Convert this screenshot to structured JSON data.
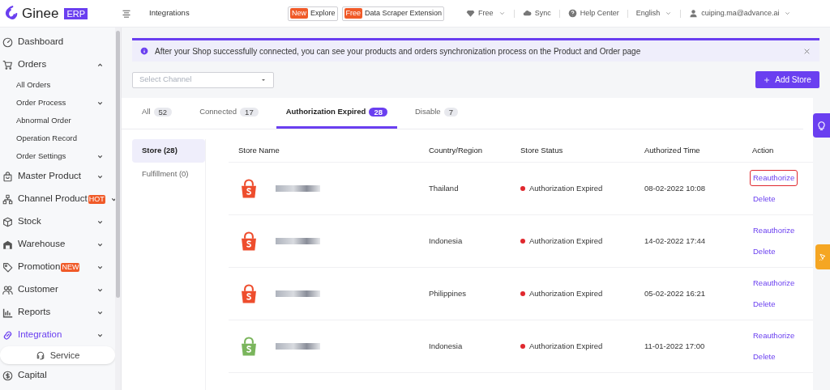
{
  "header": {
    "logo_text": "Ginee",
    "logo_badge": "ERP",
    "page_title": "Integrations",
    "promos": [
      {
        "tag": "New",
        "label": "Explore"
      },
      {
        "tag": "Free",
        "label": "Data Scraper Extension"
      }
    ],
    "menu": [
      {
        "kind": "plan",
        "label": "Free",
        "dropdown": true
      },
      {
        "kind": "sync",
        "label": "Sync",
        "dropdown": false
      },
      {
        "kind": "help",
        "label": "Help Center",
        "dropdown": false
      },
      {
        "kind": "language",
        "label": "English",
        "dropdown": true
      },
      {
        "kind": "user",
        "label": "cuiping.ma@advance.ai",
        "dropdown": true
      }
    ]
  },
  "sidebar": {
    "items": [
      {
        "kind": "dashboard",
        "label": "Dashboard",
        "selected": false
      },
      {
        "kind": "cart",
        "label": "Orders",
        "selected": false,
        "expanded": true,
        "children": [
          {
            "label": "All Orders"
          },
          {
            "label": "Order Process",
            "expanded": false
          },
          {
            "label": "Abnormal Order"
          },
          {
            "label": "Operation Record"
          },
          {
            "label": "Order Settings",
            "expanded": false
          }
        ]
      },
      {
        "kind": "bag",
        "label": "Master Product",
        "selected": false,
        "expanded": false
      },
      {
        "kind": "network",
        "label": "Channel Product",
        "badge": "HOT",
        "selected": false,
        "expanded": false
      },
      {
        "kind": "box",
        "label": "Stock",
        "selected": false,
        "expanded": false
      },
      {
        "kind": "warehouse",
        "label": "Warehouse",
        "selected": false,
        "expanded": false
      },
      {
        "kind": "tag",
        "label": "Promotion",
        "badge": "NEW",
        "selected": false,
        "expanded": false
      },
      {
        "kind": "people",
        "label": "Customer",
        "selected": false,
        "expanded": false
      },
      {
        "kind": "chart",
        "label": "Reports",
        "selected": false,
        "expanded": false
      },
      {
        "kind": "link",
        "label": "Integration",
        "selected": true,
        "expanded": false
      },
      {
        "kind": "dollar",
        "label": "Capital",
        "selected": false
      }
    ],
    "service_button": "Service"
  },
  "banner": {
    "text": "After your Shop successfully connected, you can see your products and orders synchronization process on the Product and Order page",
    "closable": true
  },
  "channel_select": {
    "placeholder": "Select Channel"
  },
  "add_store_button": "Add Store",
  "tabs": [
    {
      "label": "All",
      "count": "52",
      "selected": false
    },
    {
      "label": "Connected",
      "count": "17",
      "selected": false
    },
    {
      "label": "Authorization Expired",
      "count": "28",
      "selected": true
    },
    {
      "label": "Disable",
      "count": "7",
      "selected": false
    }
  ],
  "side_tabs": [
    {
      "label": "Store (28)",
      "selected": true
    },
    {
      "label": "Fulfillment (0)",
      "selected": false
    }
  ],
  "table": {
    "columns": [
      "Store Name",
      "Country/Region",
      "Store Status",
      "Authorized Time",
      "Action"
    ],
    "rows": [
      {
        "kind": "orange_bag",
        "country": "Thailand",
        "status": "Authorization Expired",
        "color": "#e0282e",
        "time": "08-02-2022 10:08",
        "actions": [
          {
            "label": "Reauthorize",
            "highlighted": true
          },
          {
            "label": "Delete",
            "highlighted": false
          }
        ]
      },
      {
        "kind": "orange_bag",
        "country": "Indonesia",
        "status": "Authorization Expired",
        "color": "#e0282e",
        "time": "14-02-2022 17:44",
        "actions": [
          {
            "label": "Reauthorize",
            "highlighted": false
          },
          {
            "label": "Delete",
            "highlighted": false
          }
        ]
      },
      {
        "kind": "orange_bag",
        "country": "Philippines",
        "status": "Authorization Expired",
        "color": "#e0282e",
        "time": "05-02-2022 16:21",
        "actions": [
          {
            "label": "Reauthorize",
            "highlighted": false
          },
          {
            "label": "Delete",
            "highlighted": false
          }
        ]
      },
      {
        "kind": "green_bag",
        "country": "Indonesia",
        "status": "Authorization Expired",
        "color": "#e0282e",
        "time": "11-01-2022 17:00",
        "actions": [
          {
            "label": "Reauthorize",
            "highlighted": false
          },
          {
            "label": "Delete",
            "highlighted": false
          }
        ]
      }
    ]
  }
}
